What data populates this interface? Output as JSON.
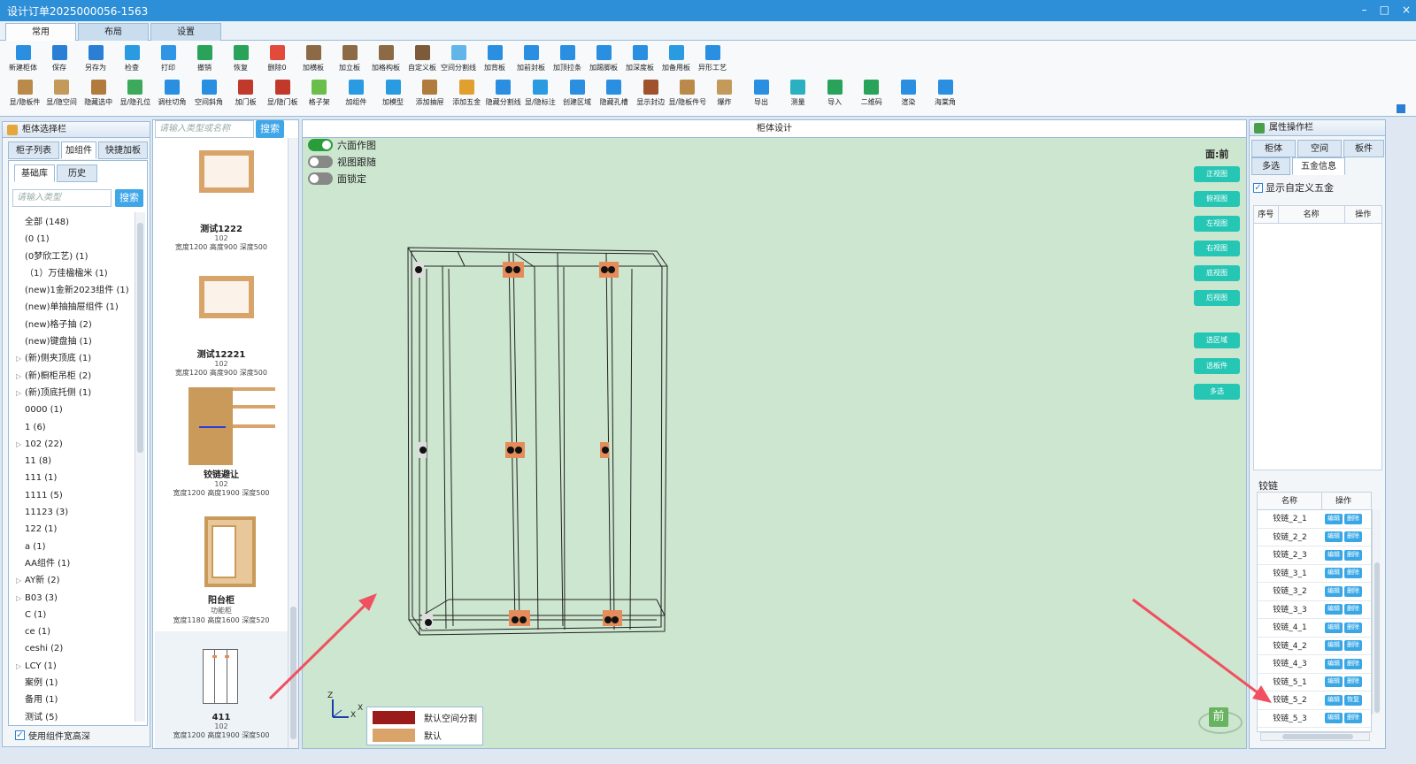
{
  "window": {
    "title": "设计订单2025000056-1563",
    "controls": [
      "–",
      "□",
      "×"
    ]
  },
  "tabs": [
    "常用",
    "布局",
    "设置"
  ],
  "ribbon": {
    "row1": [
      {
        "label": "新建柜体",
        "color": "#2a8fe0"
      },
      {
        "label": "保存",
        "color": "#2a7fd4"
      },
      {
        "label": "另存为",
        "color": "#2a7fd4"
      },
      {
        "label": "检查",
        "color": "#2a9be0"
      },
      {
        "label": "打印",
        "color": "#2f95e4"
      },
      {
        "label": "撤销",
        "color": "#2aa35a"
      },
      {
        "label": "恢复",
        "color": "#2aa35a"
      },
      {
        "label": "删除0",
        "color": "#e24b3b"
      },
      {
        "label": "加横板",
        "color": "#8c6a45"
      },
      {
        "label": "加立板",
        "color": "#8c6a45"
      },
      {
        "label": "加格构板",
        "color": "#8c6a45"
      },
      {
        "label": "自定义板",
        "color": "#7c5a3a"
      },
      {
        "label": "空间分割线",
        "color": "#62b5e8"
      },
      {
        "label": "加背板",
        "color": "#2a8fe0"
      },
      {
        "label": "加前封板",
        "color": "#2a8fe0"
      },
      {
        "label": "加顶拉条",
        "color": "#2a8fe0"
      },
      {
        "label": "加踢脚板",
        "color": "#2a8fe0"
      },
      {
        "label": "加深度板",
        "color": "#2a8fe0"
      },
      {
        "label": "加备用板",
        "color": "#2a9be0"
      },
      {
        "label": "异形工艺",
        "color": "#2a8fe0"
      }
    ],
    "row2": [
      {
        "label": "显/隐板件",
        "color": "#b98a4a"
      },
      {
        "label": "显/隐空间",
        "color": "#c49a5a"
      },
      {
        "label": "隐藏选中",
        "color": "#b07b3c"
      },
      {
        "label": "显/隐孔位",
        "color": "#3caa5a"
      },
      {
        "label": "调柱切角",
        "color": "#2a8fe0"
      },
      {
        "label": "空间斜角",
        "color": "#2a8fe0"
      },
      {
        "label": "加门板",
        "color": "#c0392b"
      },
      {
        "label": "显/隐门板",
        "color": "#c0392b"
      },
      {
        "label": "格子架",
        "color": "#6abf4b"
      },
      {
        "label": "加组件",
        "color": "#2a9be0"
      },
      {
        "label": "加模型",
        "color": "#2a9be0"
      },
      {
        "label": "添加抽屉",
        "color": "#b07b3c"
      },
      {
        "label": "添加五金",
        "color": "#e0a030"
      },
      {
        "label": "隐藏分割线",
        "color": "#2a8fe0"
      },
      {
        "label": "显/隐标注",
        "color": "#2a9be0"
      },
      {
        "label": "创建区域",
        "color": "#2a8fe0"
      },
      {
        "label": "隐藏孔槽",
        "color": "#2a8fe0"
      },
      {
        "label": "显示封边",
        "color": "#a0522d"
      },
      {
        "label": "显/隐板件号",
        "color": "#b98a4a"
      },
      {
        "label": "爆炸",
        "color": "#c49a5a"
      },
      {
        "label": "导出",
        "color": "#2a8fe0"
      },
      {
        "label": "测量",
        "color": "#2ab0c0"
      },
      {
        "label": "导入",
        "color": "#2aa35a"
      },
      {
        "label": "二维码",
        "color": "#2aa35a"
      },
      {
        "label": "渲染",
        "color": "#2a8fe0"
      },
      {
        "label": "海棠角",
        "color": "#2a8fe0"
      }
    ]
  },
  "left_panel": {
    "title": "柜体选择栏",
    "tabs": [
      "柜子列表",
      "加组件",
      "快捷加板"
    ],
    "subtabs": [
      "基础库",
      "历史"
    ],
    "search_placeholder": "请输入类型",
    "search_button": "搜索",
    "tree": [
      {
        "label": "全部 (148)",
        "exp": false
      },
      {
        "label": "(0 (1)",
        "exp": false
      },
      {
        "label": "(0梦欣工艺) (1)",
        "exp": false
      },
      {
        "label": "（1）万佳楹楹米 (1)",
        "exp": false
      },
      {
        "label": "(new)1金新2023组件 (1)",
        "exp": false
      },
      {
        "label": "(new)单抽抽屉组件 (1)",
        "exp": false
      },
      {
        "label": "(new)格子抽 (2)",
        "exp": false
      },
      {
        "label": "(new)键盘抽 (1)",
        "exp": false
      },
      {
        "label": "(新)侧夹顶底 (1)",
        "exp": true
      },
      {
        "label": "(新)橱柜吊柜 (2)",
        "exp": true
      },
      {
        "label": "(新)顶底托侧 (1)",
        "exp": true
      },
      {
        "label": "0000 (1)",
        "exp": false
      },
      {
        "label": "1 (6)",
        "exp": false
      },
      {
        "label": "102 (22)",
        "exp": true
      },
      {
        "label": "11 (8)",
        "exp": false
      },
      {
        "label": "111 (1)",
        "exp": false
      },
      {
        "label": "1111 (5)",
        "exp": false
      },
      {
        "label": "11123 (3)",
        "exp": false
      },
      {
        "label": "122 (1)",
        "exp": false
      },
      {
        "label": "a (1)",
        "exp": false
      },
      {
        "label": "AA组件 (1)",
        "exp": false
      },
      {
        "label": "AY新 (2)",
        "exp": true
      },
      {
        "label": "B03 (3)",
        "exp": true
      },
      {
        "label": "C (1)",
        "exp": false
      },
      {
        "label": "ce (1)",
        "exp": false
      },
      {
        "label": "ceshi (2)",
        "exp": false
      },
      {
        "label": "LCY (1)",
        "exp": true
      },
      {
        "label": "案例 (1)",
        "exp": false
      },
      {
        "label": "备用 (1)",
        "exp": false
      },
      {
        "label": "测试 (5)",
        "exp": false
      }
    ],
    "checkbox_label": "使用组件宽高深"
  },
  "component_list": {
    "search_placeholder": "请输入类型或名称",
    "search_button": "搜索",
    "items": [
      {
        "name": "测试1222",
        "code": "102",
        "dims": "宽度1200 高度900 深度500",
        "kind": "frame"
      },
      {
        "name": "测试12221",
        "code": "102",
        "dims": "宽度1200 高度900 深度500",
        "kind": "frame"
      },
      {
        "name": "铰链避让",
        "code": "102",
        "dims": "宽度1200 高度1900 深度500",
        "kind": "hinge"
      },
      {
        "name": "阳台柜",
        "code": "功能柜",
        "dims": "宽度1180 高度1600 深度520",
        "kind": "cabinet"
      },
      {
        "name": "411",
        "code": "102",
        "dims": "宽度1200 高度1900 深度500",
        "kind": "wire"
      }
    ]
  },
  "viewport": {
    "title": "柜体设计",
    "toggles": [
      {
        "label": "六面作图",
        "on": true
      },
      {
        "label": "视图跟随",
        "on": false
      },
      {
        "label": "面锁定",
        "on": false
      }
    ],
    "face_label": "面:前",
    "view_buttons": [
      "正视图",
      "俯视图",
      "左视图",
      "右视图",
      "底视图",
      "后视图"
    ],
    "select_buttons": [
      "选区域",
      "选板件",
      "多选"
    ],
    "legend": [
      {
        "label": "默认空间分割",
        "color": "#9b1a1a"
      },
      {
        "label": "默认",
        "color": "#d9a36a"
      }
    ],
    "axes": {
      "z": "Z",
      "x": "X"
    },
    "cube_label": "前"
  },
  "right_panel": {
    "title": "属性操作栏",
    "tabs_row1": [
      "柜体",
      "空间",
      "板件"
    ],
    "tabs_row2": [
      "多选",
      "五金信息"
    ],
    "checkbox_label": "显示自定义五金",
    "table_headers": [
      "序号",
      "名称",
      "操作"
    ],
    "hinge_section": "铰链",
    "hinge_headers": [
      "名称",
      "操作"
    ],
    "hinges": [
      {
        "name": "铰链_2_1",
        "op1": "编辑",
        "op2": "删除"
      },
      {
        "name": "铰链_2_2",
        "op1": "编辑",
        "op2": "删除"
      },
      {
        "name": "铰链_2_3",
        "op1": "编辑",
        "op2": "删除"
      },
      {
        "name": "铰链_3_1",
        "op1": "编辑",
        "op2": "删除"
      },
      {
        "name": "铰链_3_2",
        "op1": "编辑",
        "op2": "删除"
      },
      {
        "name": "铰链_3_3",
        "op1": "编辑",
        "op2": "删除"
      },
      {
        "name": "铰链_4_1",
        "op1": "编辑",
        "op2": "删除"
      },
      {
        "name": "铰链_4_2",
        "op1": "编辑",
        "op2": "删除"
      },
      {
        "name": "铰链_4_3",
        "op1": "编辑",
        "op2": "删除"
      },
      {
        "name": "铰链_5_1",
        "op1": "编辑",
        "op2": "删除"
      },
      {
        "name": "铰链_5_2",
        "op1": "编辑",
        "op2": "恢复"
      },
      {
        "name": "铰链_5_3",
        "op1": "编辑",
        "op2": "删除"
      }
    ]
  }
}
